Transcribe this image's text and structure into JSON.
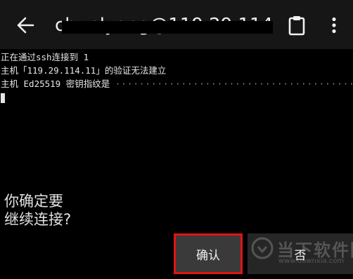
{
  "header": {
    "title": "chunlyang@119.29.114.",
    "icons": {
      "back": "back-arrow-icon",
      "clipboard": "clipboard-icon",
      "more": "more-vert-icon"
    }
  },
  "terminal": {
    "lines": [
      "正在通过ssh连接到 1",
      "主机「119.29.114.11」的验证无法建立",
      "主机 Ed25519 密钥指纹是"
    ],
    "fingerprint_mask": "·········································:"
  },
  "dialog": {
    "question": "你确定要\n继续连接?",
    "question_line1": "你确定要",
    "question_line2": "继续连接?",
    "confirm_label": "确认",
    "deny_label": "否"
  },
  "watermark": {
    "brand": "当下软件园",
    "url": "www.downxia.com"
  },
  "colors": {
    "topbar": "#161616",
    "highlight": "#e01414",
    "confirm_bg": "#3a3a3a",
    "deny_bg": "#262626"
  }
}
